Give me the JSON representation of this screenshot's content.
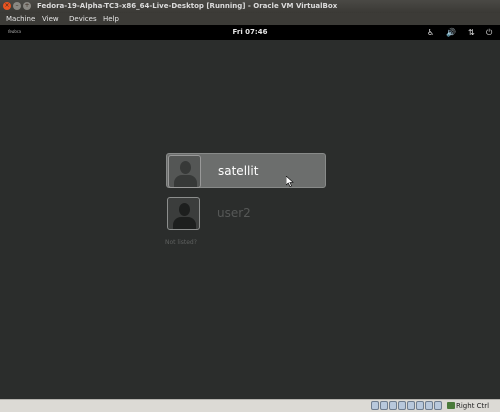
{
  "window": {
    "title": "Fedora-19-Alpha-TC3-x86_64-Live-Desktop [Running] - Oracle VM VirtualBox",
    "controls": {
      "close": "×",
      "minimize": "–",
      "maximize": "+"
    }
  },
  "menubar": {
    "items": [
      {
        "label": "Machine"
      },
      {
        "label": "View"
      },
      {
        "label": "Devices"
      },
      {
        "label": "Help"
      }
    ]
  },
  "gnome_panel": {
    "logo": "fedora",
    "clock": "Fri 07:46",
    "tray": {
      "accessibility": "♿",
      "volume": "🔊",
      "network": "⇅",
      "power": "⏻"
    }
  },
  "login": {
    "users": [
      {
        "name": "satellit",
        "selected": true
      },
      {
        "name": "user2",
        "selected": false
      }
    ],
    "not_listed": "Not listed?"
  },
  "statusbar": {
    "host_key": "Right Ctrl"
  }
}
